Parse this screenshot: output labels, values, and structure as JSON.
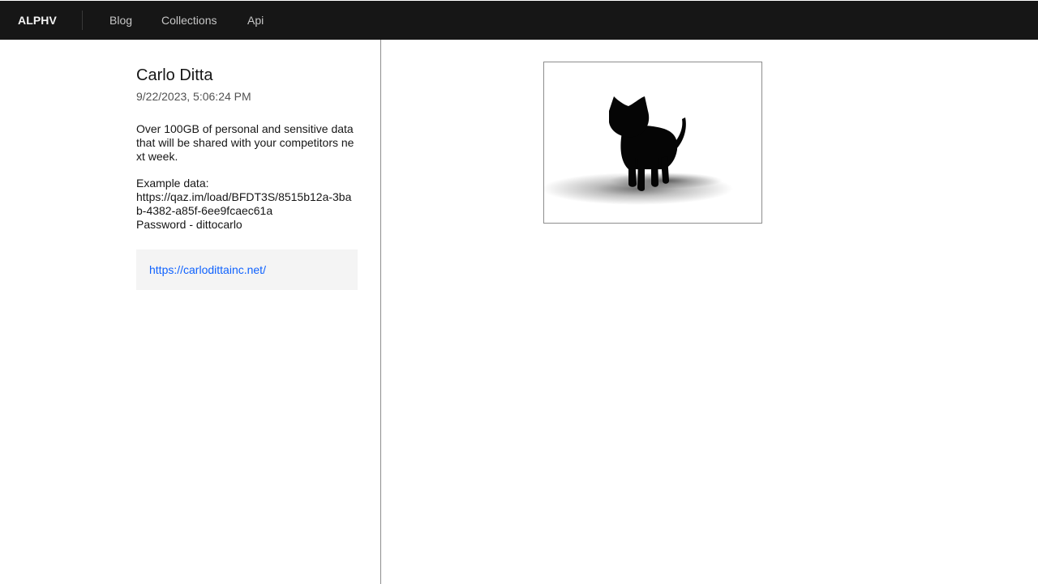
{
  "header": {
    "brand": "ALPHV",
    "nav": [
      {
        "label": "Blog"
      },
      {
        "label": "Collections"
      },
      {
        "label": "Api"
      }
    ]
  },
  "post": {
    "title": "Carlo Ditta",
    "date": "9/22/2023, 5:06:24 PM",
    "body": [
      "Over 100GB of personal and sensitive data that will be shared with your competitors next week.",
      "Example data:\nhttps://qaz.im/load/BFDT3S/8515b12a-3bab-4382-a85f-6ee9fcaec61a\nPassword - dittocarlo"
    ],
    "link": "https://carlodittainc.net/"
  },
  "image": {
    "icon": "cat-silhouette-icon"
  },
  "colors": {
    "topbar": "#161616",
    "link": "#0f62fe",
    "link_box": "#f4f4f4"
  }
}
